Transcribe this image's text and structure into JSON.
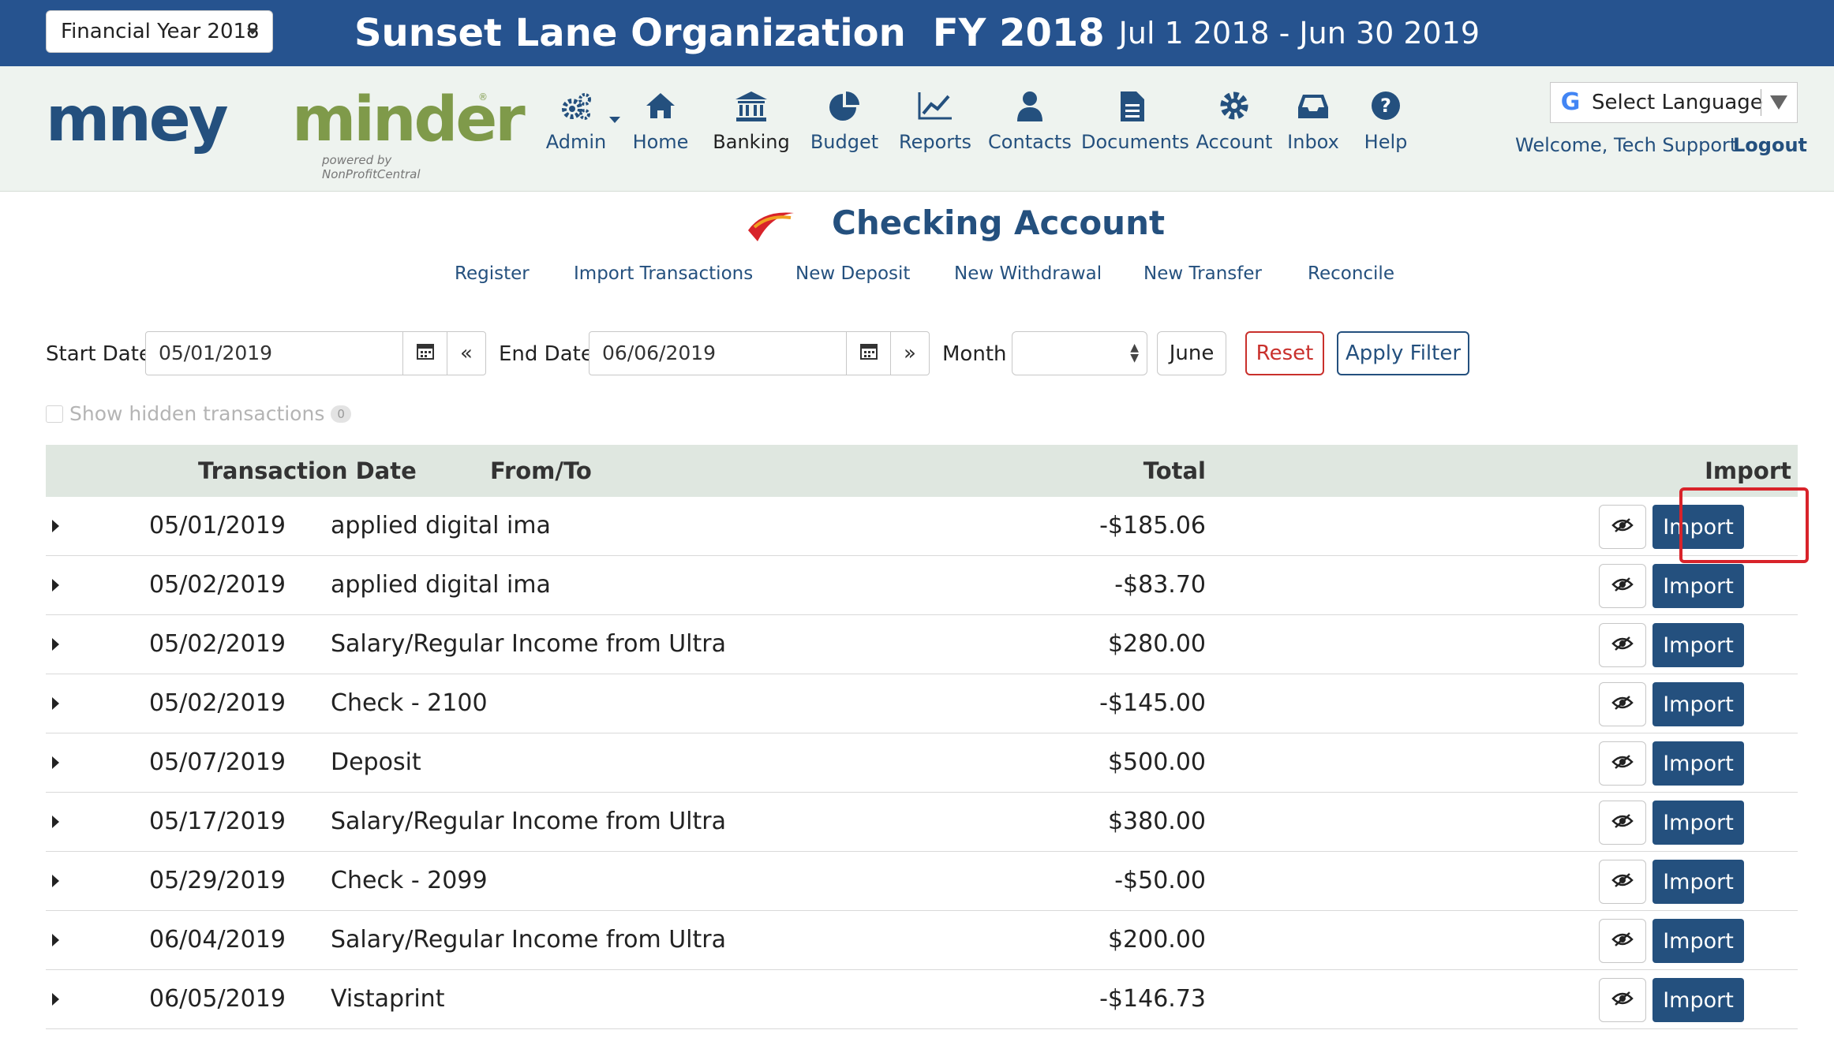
{
  "topbar": {
    "fy_select": "Financial Year 2018",
    "org_name": "Sunset Lane Organization",
    "fy_label": "FY 2018",
    "date_range": "Jul 1 2018 - Jun 30 2019",
    "color": "#26538f"
  },
  "logo": {
    "word1": "mney",
    "word2": "minder",
    "powered": "powered by NonProfitCentral"
  },
  "nav": {
    "items": [
      {
        "label": "Admin",
        "icon": "gears-icon"
      },
      {
        "label": "Home",
        "icon": "home-icon"
      },
      {
        "label": "Banking",
        "icon": "bank-icon"
      },
      {
        "label": "Budget",
        "icon": "pie-chart-icon"
      },
      {
        "label": "Reports",
        "icon": "line-chart-icon"
      },
      {
        "label": "Contacts",
        "icon": "user-icon"
      },
      {
        "label": "Documents",
        "icon": "document-icon"
      },
      {
        "label": "Account",
        "icon": "gear-icon"
      },
      {
        "label": "Inbox",
        "icon": "inbox-icon"
      },
      {
        "label": "Help",
        "icon": "help-icon"
      }
    ]
  },
  "user": {
    "language_label": "Select Language",
    "welcome": "Welcome, Tech Support",
    "logout": "Logout"
  },
  "page": {
    "title": "Checking Account",
    "subnav": [
      "Register",
      "Import Transactions",
      "New Deposit",
      "New Withdrawal",
      "New Transfer",
      "Reconcile"
    ]
  },
  "filter": {
    "start_label": "Start Date",
    "start_value": "05/01/2019",
    "end_label": "End Date",
    "end_value": "06/06/2019",
    "month_label": "Month",
    "month_button": "June",
    "reset": "Reset",
    "apply": "Apply Filter",
    "show_hidden": "Show hidden transactions",
    "hidden_count": "0"
  },
  "table": {
    "headers": {
      "date": "Transaction Date",
      "fromto": "From/To",
      "total": "Total",
      "import": "Import"
    },
    "import_label": "Import",
    "rows": [
      {
        "date": "05/01/2019",
        "fromto": "applied digital ima",
        "total": "-$185.06"
      },
      {
        "date": "05/02/2019",
        "fromto": "applied digital ima",
        "total": "-$83.70"
      },
      {
        "date": "05/02/2019",
        "fromto": "Salary/Regular Income from Ultra",
        "total": "$280.00"
      },
      {
        "date": "05/02/2019",
        "fromto": "Check - 2100",
        "total": "-$145.00"
      },
      {
        "date": "05/07/2019",
        "fromto": "Deposit",
        "total": "$500.00"
      },
      {
        "date": "05/17/2019",
        "fromto": "Salary/Regular Income from Ultra",
        "total": "$380.00"
      },
      {
        "date": "05/29/2019",
        "fromto": "Check - 2099",
        "total": "-$50.00"
      },
      {
        "date": "06/04/2019",
        "fromto": "Salary/Regular Income from Ultra",
        "total": "$200.00"
      },
      {
        "date": "06/05/2019",
        "fromto": "Vistaprint",
        "total": "-$146.73"
      }
    ]
  },
  "colors": {
    "primary": "#24507e",
    "accent_green": "#7f9a4a",
    "danger": "#c9302c",
    "highlight": "#d8232a"
  }
}
